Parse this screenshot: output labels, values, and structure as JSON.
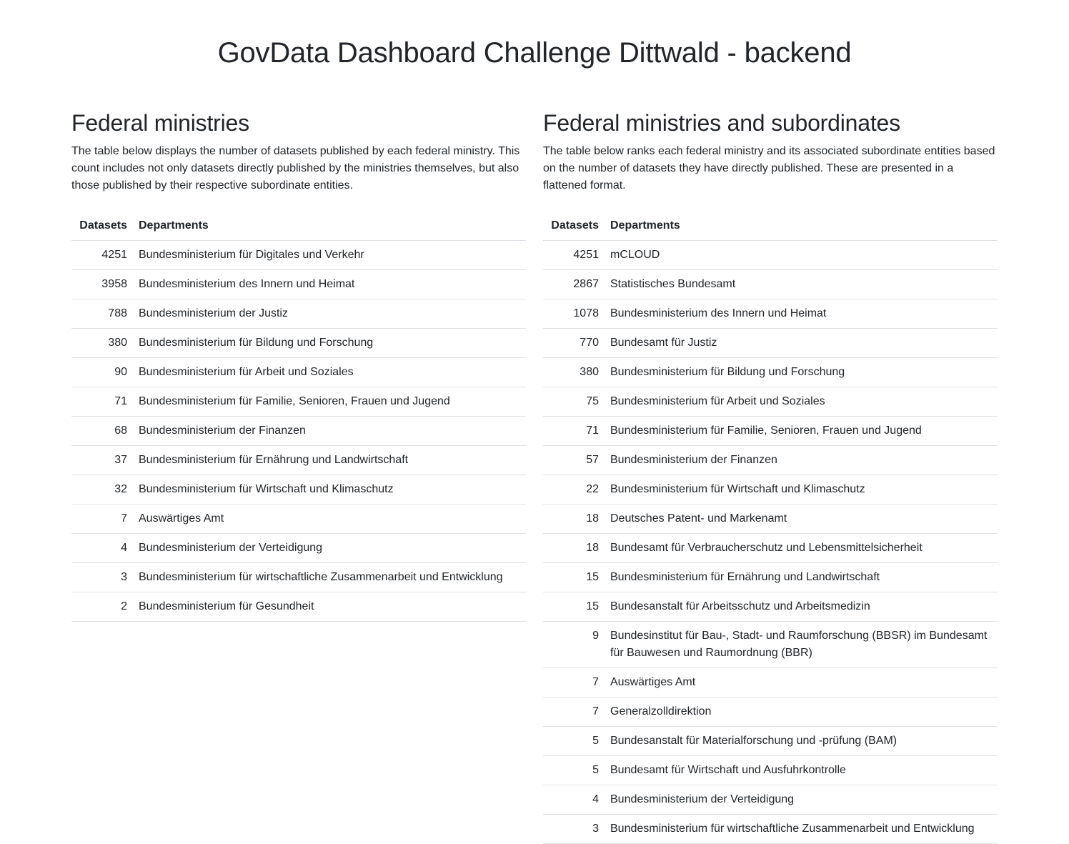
{
  "page": {
    "title": "GovData Dashboard Challenge Dittwald - backend"
  },
  "left": {
    "heading": "Federal ministries",
    "description": "The table below displays the number of datasets published by each federal ministry. This count includes not only datasets directly published by the ministries themselves, but also those published by their respective subordinate entities.",
    "columns": {
      "datasets": "Datasets",
      "departments": "Departments"
    },
    "rows": [
      {
        "count": "4251",
        "name": "Bundesministerium für Digitales und Verkehr"
      },
      {
        "count": "3958",
        "name": "Bundesministerium des Innern und Heimat"
      },
      {
        "count": "788",
        "name": "Bundesministerium der Justiz"
      },
      {
        "count": "380",
        "name": "Bundesministerium für Bildung und Forschung"
      },
      {
        "count": "90",
        "name": "Bundesministerium für Arbeit und Soziales"
      },
      {
        "count": "71",
        "name": "Bundesministerium für Familie, Senioren, Frauen und Jugend"
      },
      {
        "count": "68",
        "name": "Bundesministerium der Finanzen"
      },
      {
        "count": "37",
        "name": "Bundesministerium für Ernährung und Landwirtschaft"
      },
      {
        "count": "32",
        "name": "Bundesministerium für Wirtschaft und Klimaschutz"
      },
      {
        "count": "7",
        "name": "Auswärtiges Amt"
      },
      {
        "count": "4",
        "name": "Bundesministerium der Verteidigung"
      },
      {
        "count": "3",
        "name": "Bundesministerium für wirtschaftliche Zusammenarbeit und Entwicklung"
      },
      {
        "count": "2",
        "name": "Bundesministerium für Gesundheit"
      }
    ]
  },
  "right": {
    "heading": "Federal ministries and subordinates",
    "description": "The table below ranks each federal ministry and its associated subordinate entities based on the number of datasets they have directly published. These are presented in a flattened format.",
    "columns": {
      "datasets": "Datasets",
      "departments": "Departments"
    },
    "rows": [
      {
        "count": "4251",
        "name": "mCLOUD"
      },
      {
        "count": "2867",
        "name": "Statistisches Bundesamt"
      },
      {
        "count": "1078",
        "name": "Bundesministerium des Innern und Heimat"
      },
      {
        "count": "770",
        "name": "Bundesamt für Justiz"
      },
      {
        "count": "380",
        "name": "Bundesministerium für Bildung und Forschung"
      },
      {
        "count": "75",
        "name": "Bundesministerium für Arbeit und Soziales"
      },
      {
        "count": "71",
        "name": "Bundesministerium für Familie, Senioren, Frauen und Jugend"
      },
      {
        "count": "57",
        "name": "Bundesministerium der Finanzen"
      },
      {
        "count": "22",
        "name": "Bundesministerium für Wirtschaft und Klimaschutz"
      },
      {
        "count": "18",
        "name": "Deutsches Patent- und Markenamt"
      },
      {
        "count": "18",
        "name": "Bundesamt für Verbraucherschutz und Lebensmittelsicherheit"
      },
      {
        "count": "15",
        "name": "Bundesministerium für Ernährung und Landwirtschaft"
      },
      {
        "count": "15",
        "name": "Bundesanstalt für Arbeitsschutz und Arbeitsmedizin"
      },
      {
        "count": "9",
        "name": "Bundesinstitut für Bau-, Stadt- und Raumforschung (BBSR) im Bundesamt für Bauwesen und Raumordnung (BBR)"
      },
      {
        "count": "7",
        "name": "Auswärtiges Amt"
      },
      {
        "count": "7",
        "name": "Generalzolldirektion"
      },
      {
        "count": "5",
        "name": "Bundesanstalt für Materialforschung und -prüfung (BAM)"
      },
      {
        "count": "5",
        "name": "Bundesamt für Wirtschaft und Ausfuhrkontrolle"
      },
      {
        "count": "4",
        "name": "Bundesministerium der Verteidigung"
      },
      {
        "count": "3",
        "name": "Bundesministerium für wirtschaftliche Zusammenarbeit und Entwicklung"
      }
    ]
  }
}
